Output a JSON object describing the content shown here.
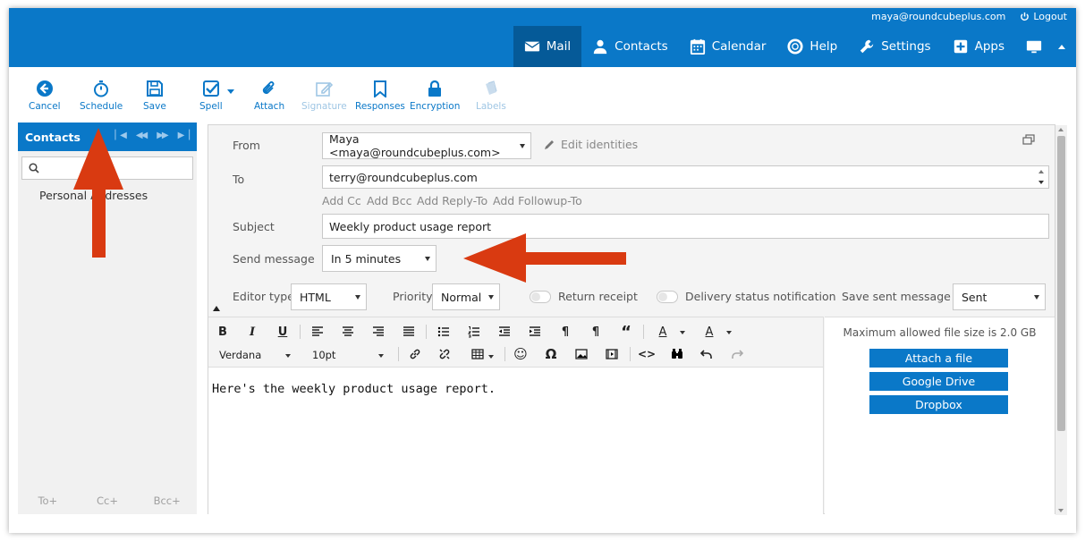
{
  "header": {
    "user": "maya@roundcubeplus.com",
    "logout": "Logout",
    "nav": [
      {
        "label": "Mail",
        "icon": "envelope-icon",
        "active": true
      },
      {
        "label": "Contacts",
        "icon": "person-icon"
      },
      {
        "label": "Calendar",
        "icon": "calendar-icon"
      },
      {
        "label": "Help",
        "icon": "lifebuoy-icon"
      },
      {
        "label": "Settings",
        "icon": "wrench-icon"
      },
      {
        "label": "Apps",
        "icon": "plus-square-icon"
      }
    ]
  },
  "toolbar": {
    "cancel": "Cancel",
    "schedule": "Schedule",
    "save": "Save",
    "spell": "Spell",
    "attach": "Attach",
    "signature": "Signature",
    "responses": "Responses",
    "encryption": "Encryption",
    "labels": "Labels"
  },
  "contacts": {
    "title": "Contacts",
    "search_placeholder": "",
    "group": "Personal Addresses",
    "recipient_buttons": [
      "To+",
      "Cc+",
      "Bcc+"
    ]
  },
  "compose": {
    "from_label": "From",
    "from_value": "Maya <maya@roundcubeplus.com>",
    "edit_identities": "Edit identities",
    "to_label": "To",
    "to_value": "terry@roundcubeplus.com",
    "add_links": [
      "Add Cc",
      "Add Bcc",
      "Add Reply-To",
      "Add Followup-To"
    ],
    "subject_label": "Subject",
    "subject_value": "Weekly product usage report",
    "send_label": "Send message",
    "send_value": "In 5 minutes",
    "editor_type_label": "Editor type",
    "editor_type_value": "HTML",
    "priority_label": "Priority",
    "priority_value": "Normal",
    "return_receipt": "Return receipt",
    "delivery_notification": "Delivery status notification",
    "save_sent_label": "Save sent message in",
    "save_sent_value": "Sent"
  },
  "editor": {
    "font": "Verdana",
    "size": "10pt",
    "body": "Here's the weekly product usage report."
  },
  "attachments": {
    "max_size": "Maximum allowed file size is 2.0 GB",
    "buttons": [
      "Attach a file",
      "Google Drive",
      "Dropbox"
    ]
  },
  "colors": {
    "brand": "#0a78c8",
    "annotation_arrow": "#d93a11"
  }
}
